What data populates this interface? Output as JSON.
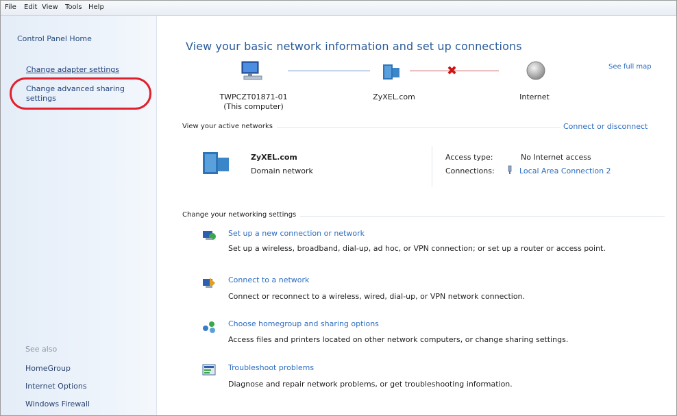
{
  "menu": [
    "File",
    "Edit",
    "View",
    "Tools",
    "Help"
  ],
  "sidebar": {
    "home": "Control Panel Home",
    "links": [
      "Change adapter settings",
      "Change advanced sharing settings"
    ],
    "see_also_label": "See also",
    "see_also": [
      "HomeGroup",
      "Internet Options",
      "Windows Firewall"
    ]
  },
  "main": {
    "heading": "View your basic network information and set up connections",
    "see_full_map": "See full map",
    "map": {
      "computer_name": "TWPCZT01871-01",
      "computer_sub": "(This computer)",
      "network": "ZyXEL.com",
      "internet": "Internet"
    },
    "active_networks": {
      "title": "View your active networks",
      "connect_link": "Connect or disconnect",
      "name": "ZyXEL.com",
      "type": "Domain network",
      "access_type_label": "Access type:",
      "access_type_value": "No Internet access",
      "connections_label": "Connections:",
      "connections_value": "Local Area Connection 2"
    },
    "networking": {
      "title": "Change your networking settings",
      "tasks": [
        {
          "link": "Set up a new connection or network",
          "desc": "Set up a wireless, broadband, dial-up, ad hoc, or VPN connection; or set up a router or access point."
        },
        {
          "link": "Connect to a network",
          "desc": "Connect or reconnect to a wireless, wired, dial-up, or VPN network connection."
        },
        {
          "link": "Choose homegroup and sharing options",
          "desc": "Access files and printers located on other network computers, or change sharing settings."
        },
        {
          "link": "Troubleshoot problems",
          "desc": "Diagnose and repair network problems, or get troubleshooting information."
        }
      ]
    }
  },
  "colors": {
    "link": "#2a6cc0",
    "heading": "#2a5c9a",
    "highlight": "#e0202c",
    "pane": "#e4edf8"
  }
}
